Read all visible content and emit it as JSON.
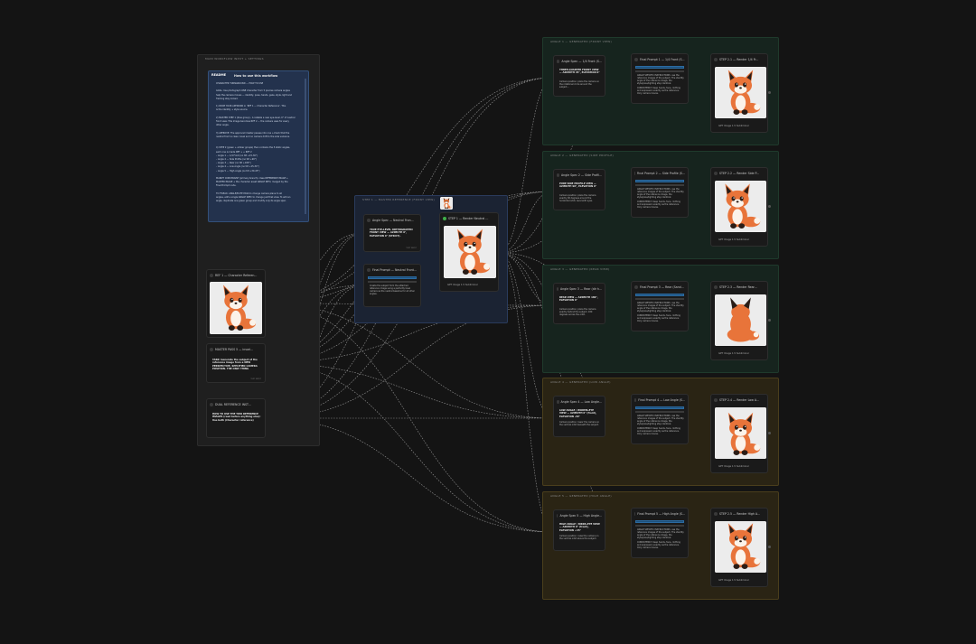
{
  "groups": {
    "inputs": "MAIN WORKFLOW INPUT + SETTINGS",
    "step1": "STEP 1 — MASTER REFERENCE (FRONT VIEW)",
    "front": "ANGLE 1 — GENERATED (FRONT VIEW)",
    "side": "ANGLE 2 — GENERATED (SIDE PROFILE)",
    "rear": "ANGLE 3 — GENERATED (REAR VIEW)",
    "low": "ANGLE 4 — GENERATED (LOW ANGLE)",
    "high": "ANGLE 5 — GENERATED (HIGH ANGLE)"
  },
  "note": {
    "badge": "README",
    "title": "How to use this workflow",
    "lines": [
      "CHARACTER TURNAROUND — HOW TO USE",
      "",
      "GOAL: Use photograph ONE character from 5 precise camera angles",
      "help the camera moves — identity, pose, hands, gaze, style, light and",
      "framing stay locked.",
      "",
      "1) DROP YOUR ARTWORK in ‘REF 1 — Character Reference’. This",
      "is the identity + style source.",
      "",
      "2) MASTER STEP 1 (blue group) - A reliable a new eye-level, 0° of neutral",
      "front view. This image becomes REF 2 — the camera uses for every",
      "other angle.",
      "",
      "3) APPROVE: The approved master passes into one +check that the",
      "neutral front is clean; level and no camera drift to the side variance.",
      "",
      "",
      "4) STEP 2 (green + amber groups) then contains the 5 static angles,",
      "each one is made REF + + REF 2",
      " – Angle 1 — 1/4 Front (no tilt +15-30°)",
      " – Angle 2 — Side Profile (no tilt +90°)",
      " – Angle 3 — Rear (no tilt +180°)",
      " – Angle 4 — Low Angle (no tilt +15-30°)",
      " – Angle 5 — High Angle (no tilt +30-45°)",
      "",
      "MAINPT CONSTRAINT (primary branch): Uses REFERENCE IMAGE +",
      "MASTER IMAGE + the character asset ANGLE INFO, merged by the",
      "Final Prompt node.",
      "",
      "TO TWEAK: ANGLE/ELITE PASS to change camera plane to all",
      "angles, edit a single ANGLE SPEC to change just that view. To add an",
      "angle, duplicate one green group and modify only its angle spec."
    ]
  },
  "ref1": {
    "title": "REF 1 — Character Referen...",
    "caption": ""
  },
  "master_pass": {
    "title": "MASTER PASS 5 — invari...",
    "text": "TASK: Generate the subject of the reference image from a NEW PERSPECTIVE. SPECIFIED CAMERA POSITION. THE ONLY THING",
    "foot": "TEXT INPUT"
  },
  "dual_ref": {
    "title": "DUAL REFERENCE INST...",
    "text": "HOW TO USE THE TWO REFERENCE IMAGES (read before anything else): Use both (Character reference)",
    "foot": ""
  },
  "step1": {
    "angle_spec_title": "Angle Spec — Neutral Fron...",
    "angle_spec_text": "TRUE EYE-LEVEL ORTHOGRAPHIC FRONT VIEW — AZIMUTH 0°, ELEVATION 0° (STRICT).",
    "angle_spec_foot": "TEXT INPUT",
    "final_prompt_title": "Final Prompt — Neutral Front...",
    "final_prompt_text": "Create the subject from the attached reference image using a perfectly level camera as the neutral baseline for all other angles.",
    "output_title": "STEP 1 — Render Neutral ...",
    "output_caption": "GPT Image 1.5 Subliminal"
  },
  "angles": [
    {
      "spec_title": "Angle Spec — 1/4 Front (S...",
      "spec_text": "THREE-QUARTER FRONT VIEW — AZIMUTH 45°, ELEVATION 0°",
      "spec_sub": "Camera position: place the camera on the rotational circle around the subject...",
      "final_title": "Final Prompt 1 — 1/4 Front (S...",
      "render_title": "STEP 2.1 — Render 1/4 Fr...",
      "caption": "GPT Image 1.5 Subliminal"
    },
    {
      "spec_title": "Angle Spec 2 — Side Profil...",
      "spec_text": "PURE SIDE PROFILE VIEW — AZIMUTH 90°, ELEVATION 0°",
      "spec_sub": "Camera position: place the camera exactly 90 degrees around the horizontal orbit, level with eyes.",
      "final_title": "Final Prompt 2 — Side Profile (S...",
      "render_title": "STEP 2.2 — Render Side P...",
      "caption": "GPT Image 1.5 Subliminal"
    },
    {
      "spec_title": "Angle Spec 3 — Rear (dir h...",
      "spec_text": "REAR VIEW — AZIMUTH 180°, ELEVATION 0°",
      "spec_sub": "Camera position: place the camera exactly behind the subject, 180 degrees across the orbit.",
      "final_title": "Final Prompt 3 — Rear (Sand...",
      "render_title": "STEP 2.3 — Render Rear...",
      "caption": "GPT Image 1.5 Subliminal"
    },
    {
      "spec_title": "Angle Spec 4 — Low Angle...",
      "spec_text": "LOW ANGLE / WORMS-EYE VIEW — AZIMUTH 0° (front), ELEVATION -30°",
      "spec_sub": "Camera position: lower the camera on the vertical orbit beneath the subject.",
      "final_title": "Final Prompt 4 — Low Angle (S...",
      "render_title": "STEP 2.4 — Render Low A...",
      "caption": "GPT Image 1.5 Subliminal"
    },
    {
      "spec_title": "Angle Spec 5 — High Angle...",
      "spec_text": "HIGH ANGLE / BIRDS-EYE VIEW — AZIMUTH 0° (front), ELEVATION +45°",
      "spec_sub": "Camera position: raise the camera on the vertical orbit above the subject.",
      "final_title": "Final Prompt 5 — High Angle (S...",
      "render_title": "STEP 2.5 — Render High A...",
      "caption": "GPT Image 1.5 Subliminal"
    }
  ],
  "final_prompt_body": "ANGLE SPECIFIC INSTRUCTIONS: use the reference images of the subject. The identity angle of the reference image, the style/pose/lighting stay identical.",
  "final_prompt_body2": "CONSISTENCY: Keep hands, face, clothing and expression exactly as the reference. Only camera moves.",
  "colors": {
    "accent_blue": "#2b6aa0",
    "green_dot": "#3fae4a",
    "wire": "#bdbdbd"
  }
}
